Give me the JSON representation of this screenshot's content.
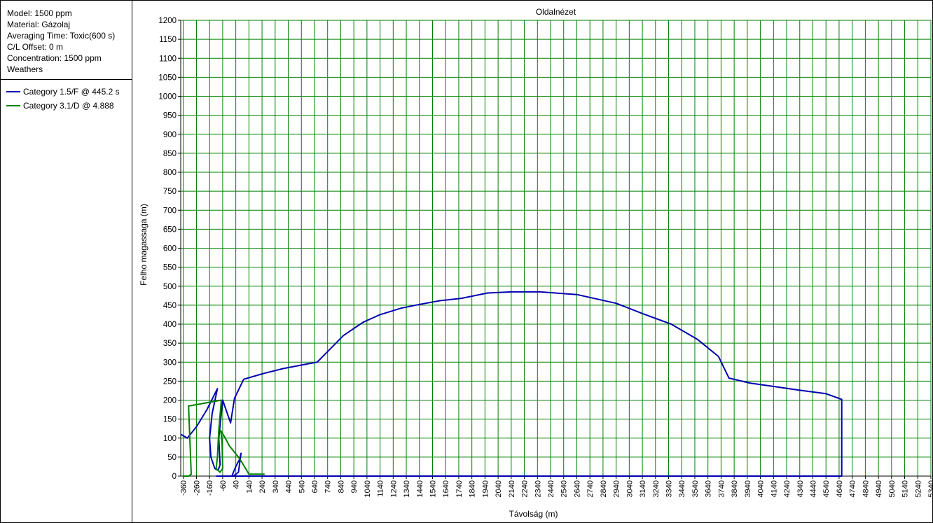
{
  "info": {
    "lines": [
      "Model: 1500 ppm",
      "Material: Gázolaj",
      "Averaging Time: Toxic(600 s)",
      "C/L Offset: 0 m",
      "Concentration: 1500 ppm",
      "Weathers"
    ]
  },
  "legend": [
    {
      "label": "Category 1.5/F @ 445.2 s",
      "color": "#0000B0"
    },
    {
      "label": "Category 3.1/D @ 4.888",
      "color": "#008000"
    }
  ],
  "chart_data": {
    "type": "line",
    "title": "Oldalnézet",
    "xlabel": "Távolság (m)",
    "ylabel": "Felho magassaga (m)",
    "grid": true,
    "grid_color": "#008000",
    "xlim": [
      -380,
      5340
    ],
    "ylim": [
      0,
      1200
    ],
    "x_ticks": [
      -360,
      -260,
      -160,
      -60,
      40,
      140,
      240,
      340,
      440,
      540,
      640,
      740,
      840,
      940,
      1040,
      1140,
      1240,
      1340,
      1440,
      1540,
      1640,
      1740,
      1840,
      1940,
      2040,
      2140,
      2240,
      2340,
      2440,
      2540,
      2640,
      2740,
      2840,
      2940,
      3040,
      3140,
      3240,
      3340,
      3440,
      3540,
      3640,
      3740,
      3840,
      3940,
      4040,
      4140,
      4240,
      4340,
      4440,
      4540,
      4640,
      4740,
      4840,
      4940,
      5040,
      5140,
      5240,
      5340
    ],
    "y_ticks": [
      0,
      50,
      100,
      150,
      200,
      250,
      300,
      350,
      400,
      450,
      500,
      550,
      600,
      650,
      700,
      750,
      800,
      850,
      900,
      950,
      1000,
      1050,
      1100,
      1150,
      1200
    ],
    "series": [
      {
        "name": "Category 1.5/F @ 445.2 s",
        "color": "#0000B0",
        "x": [
          -380,
          -330,
          -260,
          -180,
          -100,
          -140,
          -160,
          -150,
          -120,
          -95,
          -80,
          -90,
          -60,
          0,
          30,
          100,
          250,
          400,
          580,
          660,
          760,
          860,
          1010,
          1140,
          1300,
          1440,
          1600,
          1760,
          1960,
          2140,
          2360,
          2640,
          2940,
          3140,
          3360,
          3560,
          3720,
          3800,
          3960,
          4160,
          4360,
          4540,
          4660,
          4660,
          3800,
          2000,
          400,
          60,
          30,
          10,
          40,
          70,
          80,
          60,
          40,
          20,
          0,
          -20,
          -40,
          -60,
          -90,
          -110
        ],
        "y": [
          110,
          100,
          130,
          175,
          230,
          165,
          100,
          50,
          20,
          15,
          30,
          100,
          200,
          140,
          205,
          255,
          270,
          283,
          295,
          300,
          335,
          370,
          405,
          425,
          442,
          452,
          462,
          468,
          482,
          485,
          485,
          478,
          455,
          428,
          400,
          360,
          315,
          258,
          245,
          235,
          225,
          217,
          202,
          0,
          0,
          0,
          0,
          0,
          0,
          0,
          25,
          45,
          60,
          10,
          5,
          0,
          0,
          0,
          0,
          0,
          0,
          0
        ]
      },
      {
        "name": "Category 3.1/D @ 4.888",
        "color": "#008000",
        "x": [
          -360,
          -320,
          -300,
          -320,
          -310,
          -70,
          -90,
          -100,
          -110,
          -80,
          -60,
          -65,
          -75,
          -40,
          -10,
          60,
          80,
          140,
          260
        ],
        "y": [
          0,
          0,
          5,
          185,
          185,
          200,
          120,
          50,
          20,
          10,
          20,
          90,
          120,
          100,
          80,
          50,
          40,
          5,
          5
        ]
      }
    ]
  }
}
